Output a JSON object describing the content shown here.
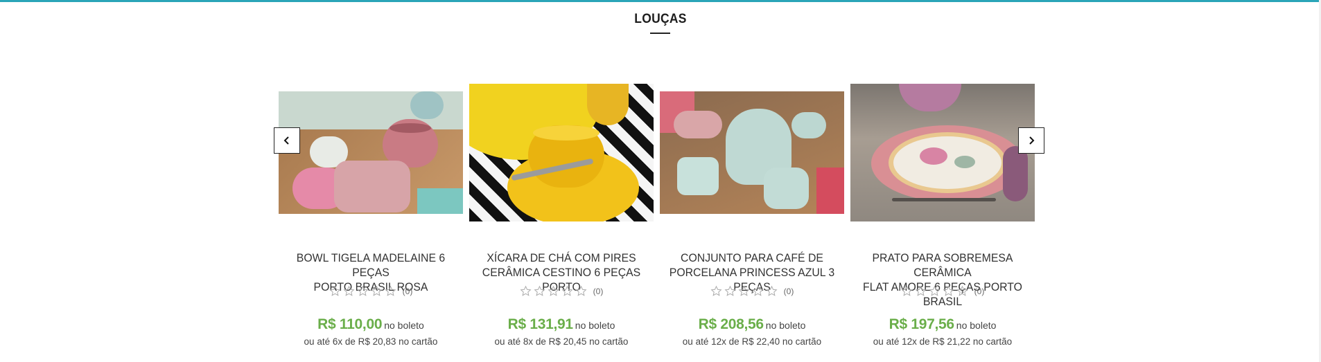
{
  "section": {
    "title": "LOUÇAS"
  },
  "carousel": {
    "prev_icon": "chevron-left-icon",
    "next_icon": "chevron-right-icon"
  },
  "products": [
    {
      "name_line1": "BOWL TIGELA MADELAINE 6 PEÇAS",
      "name_line2": "PORTO BRASIL ROSA",
      "rating_count": "(0)",
      "price": "R$ 110,00",
      "price_suffix": "no boleto",
      "installment": "ou até 6x de R$ 20,83 no cartão"
    },
    {
      "name_line1": "XÍCARA DE CHÁ COM PIRES",
      "name_line2": "CERÂMICA CESTINO 6 PEÇAS PORTO",
      "rating_count": "(0)",
      "price": "R$ 131,91",
      "price_suffix": "no boleto",
      "installment": "ou até 8x de R$ 20,45 no cartão"
    },
    {
      "name_line1": "CONJUNTO PARA CAFÉ DE",
      "name_line2": "PORCELANA PRINCESS AZUL 3 PEÇAS",
      "rating_count": "(0)",
      "price": "R$ 208,56",
      "price_suffix": "no boleto",
      "installment": "ou até 12x de R$ 22,40 no cartão"
    },
    {
      "name_line1": "PRATO PARA SOBREMESA CERÂMICA",
      "name_line2": "FLAT AMORE 6 PEÇAS PORTO BRASIL",
      "rating_count": "(0)",
      "price": "R$ 197,56",
      "price_suffix": "no boleto",
      "installment": "ou até 12x de R$ 21,22 no cartão"
    }
  ],
  "colors": {
    "accent": "#2aa5b8",
    "price": "#6aae4a"
  }
}
